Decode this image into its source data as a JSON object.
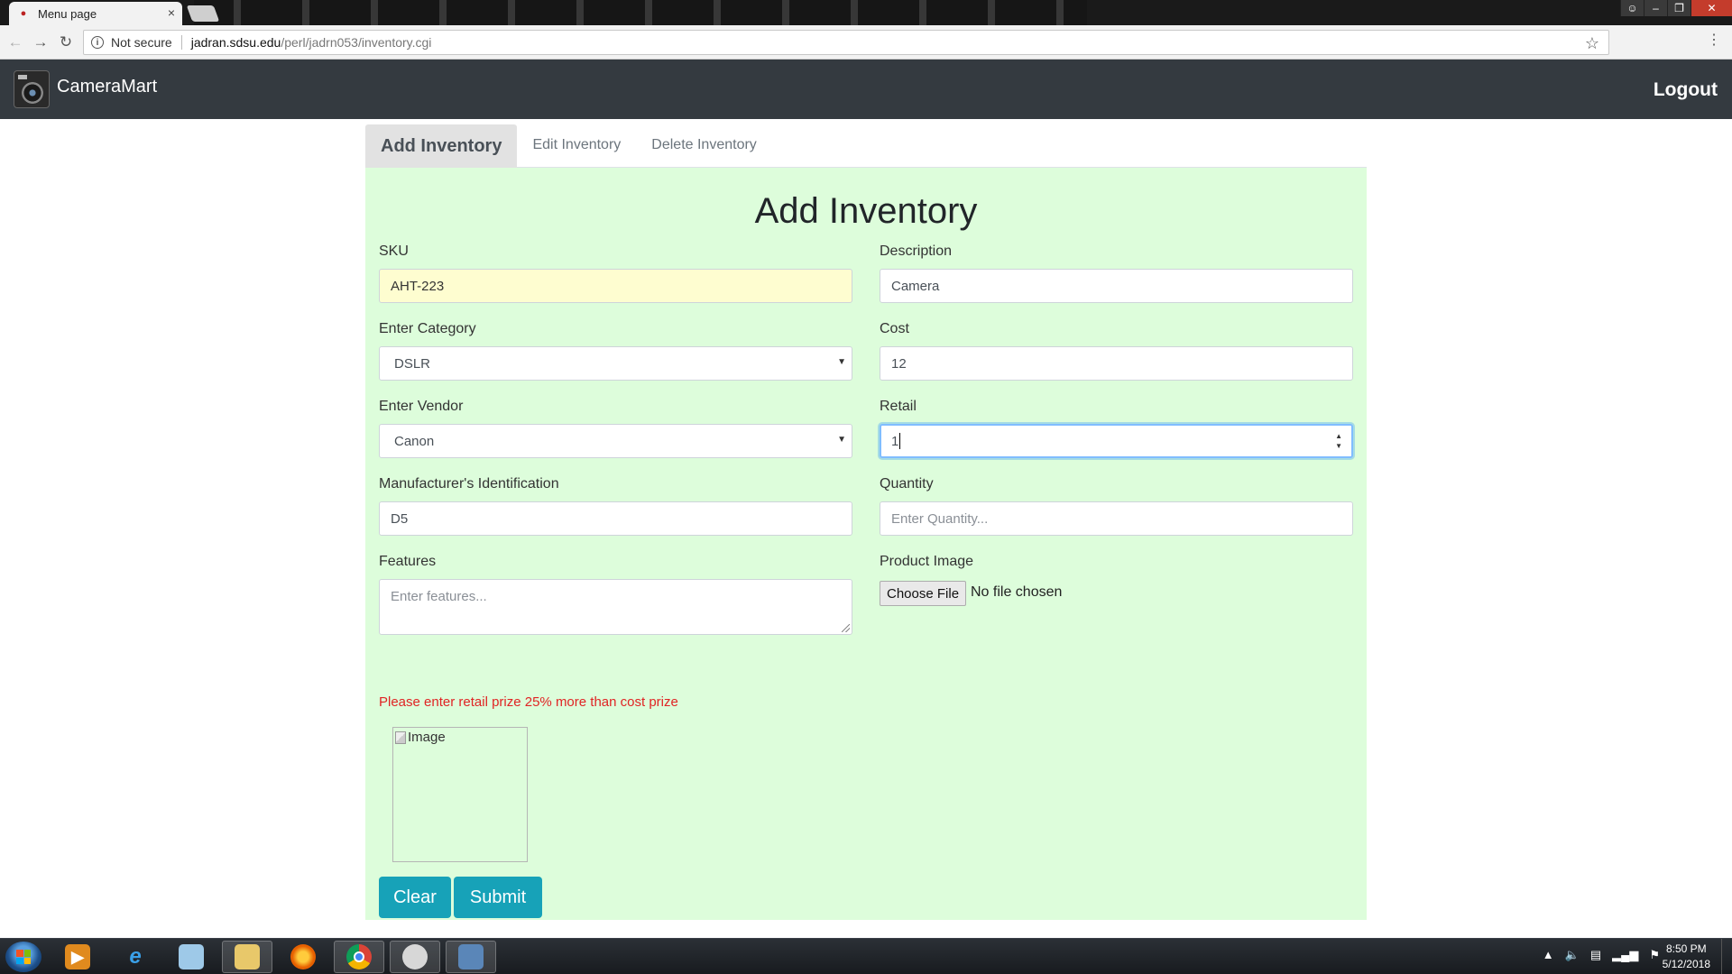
{
  "browser": {
    "tab_title": "Menu page",
    "tab_close": "×",
    "security_label": "Not secure",
    "url_host": "jadran.sdsu.edu",
    "url_path": "/perl/jadrn053/inventory.cgi"
  },
  "navbar": {
    "brand": "CameraMart",
    "logout": "Logout"
  },
  "tabs": [
    {
      "label": "Add Inventory",
      "active": true
    },
    {
      "label": "Edit Inventory",
      "active": false
    },
    {
      "label": "Delete Inventory",
      "active": false
    }
  ],
  "form": {
    "title": "Add Inventory",
    "sku": {
      "label": "SKU",
      "value": "AHT-223"
    },
    "description": {
      "label": "Description",
      "value": "Camera"
    },
    "category": {
      "label": "Enter Category",
      "value": "DSLR"
    },
    "cost": {
      "label": "Cost",
      "value": "12"
    },
    "vendor": {
      "label": "Enter Vendor",
      "value": "Canon"
    },
    "retail": {
      "label": "Retail",
      "value": "1"
    },
    "manufacturer_id": {
      "label": "Manufacturer's Identification",
      "value": "D5"
    },
    "quantity": {
      "label": "Quantity",
      "placeholder": "Enter Quantity..."
    },
    "features": {
      "label": "Features",
      "placeholder": "Enter features..."
    },
    "product_image": {
      "label": "Product Image",
      "button": "Choose File",
      "status": "No file chosen"
    },
    "error": "Please enter retail prize 25% more than cost prize",
    "image_alt": "Image",
    "clear_button": "Clear",
    "submit_button": "Submit"
  },
  "taskbar": {
    "time": "8:50 PM",
    "date": "5/12/2018"
  },
  "colors": {
    "navbar_bg": "#343a40",
    "panel_bg": "#ddfddb",
    "button_bg": "#17a2b8",
    "error_text": "#e02424"
  }
}
